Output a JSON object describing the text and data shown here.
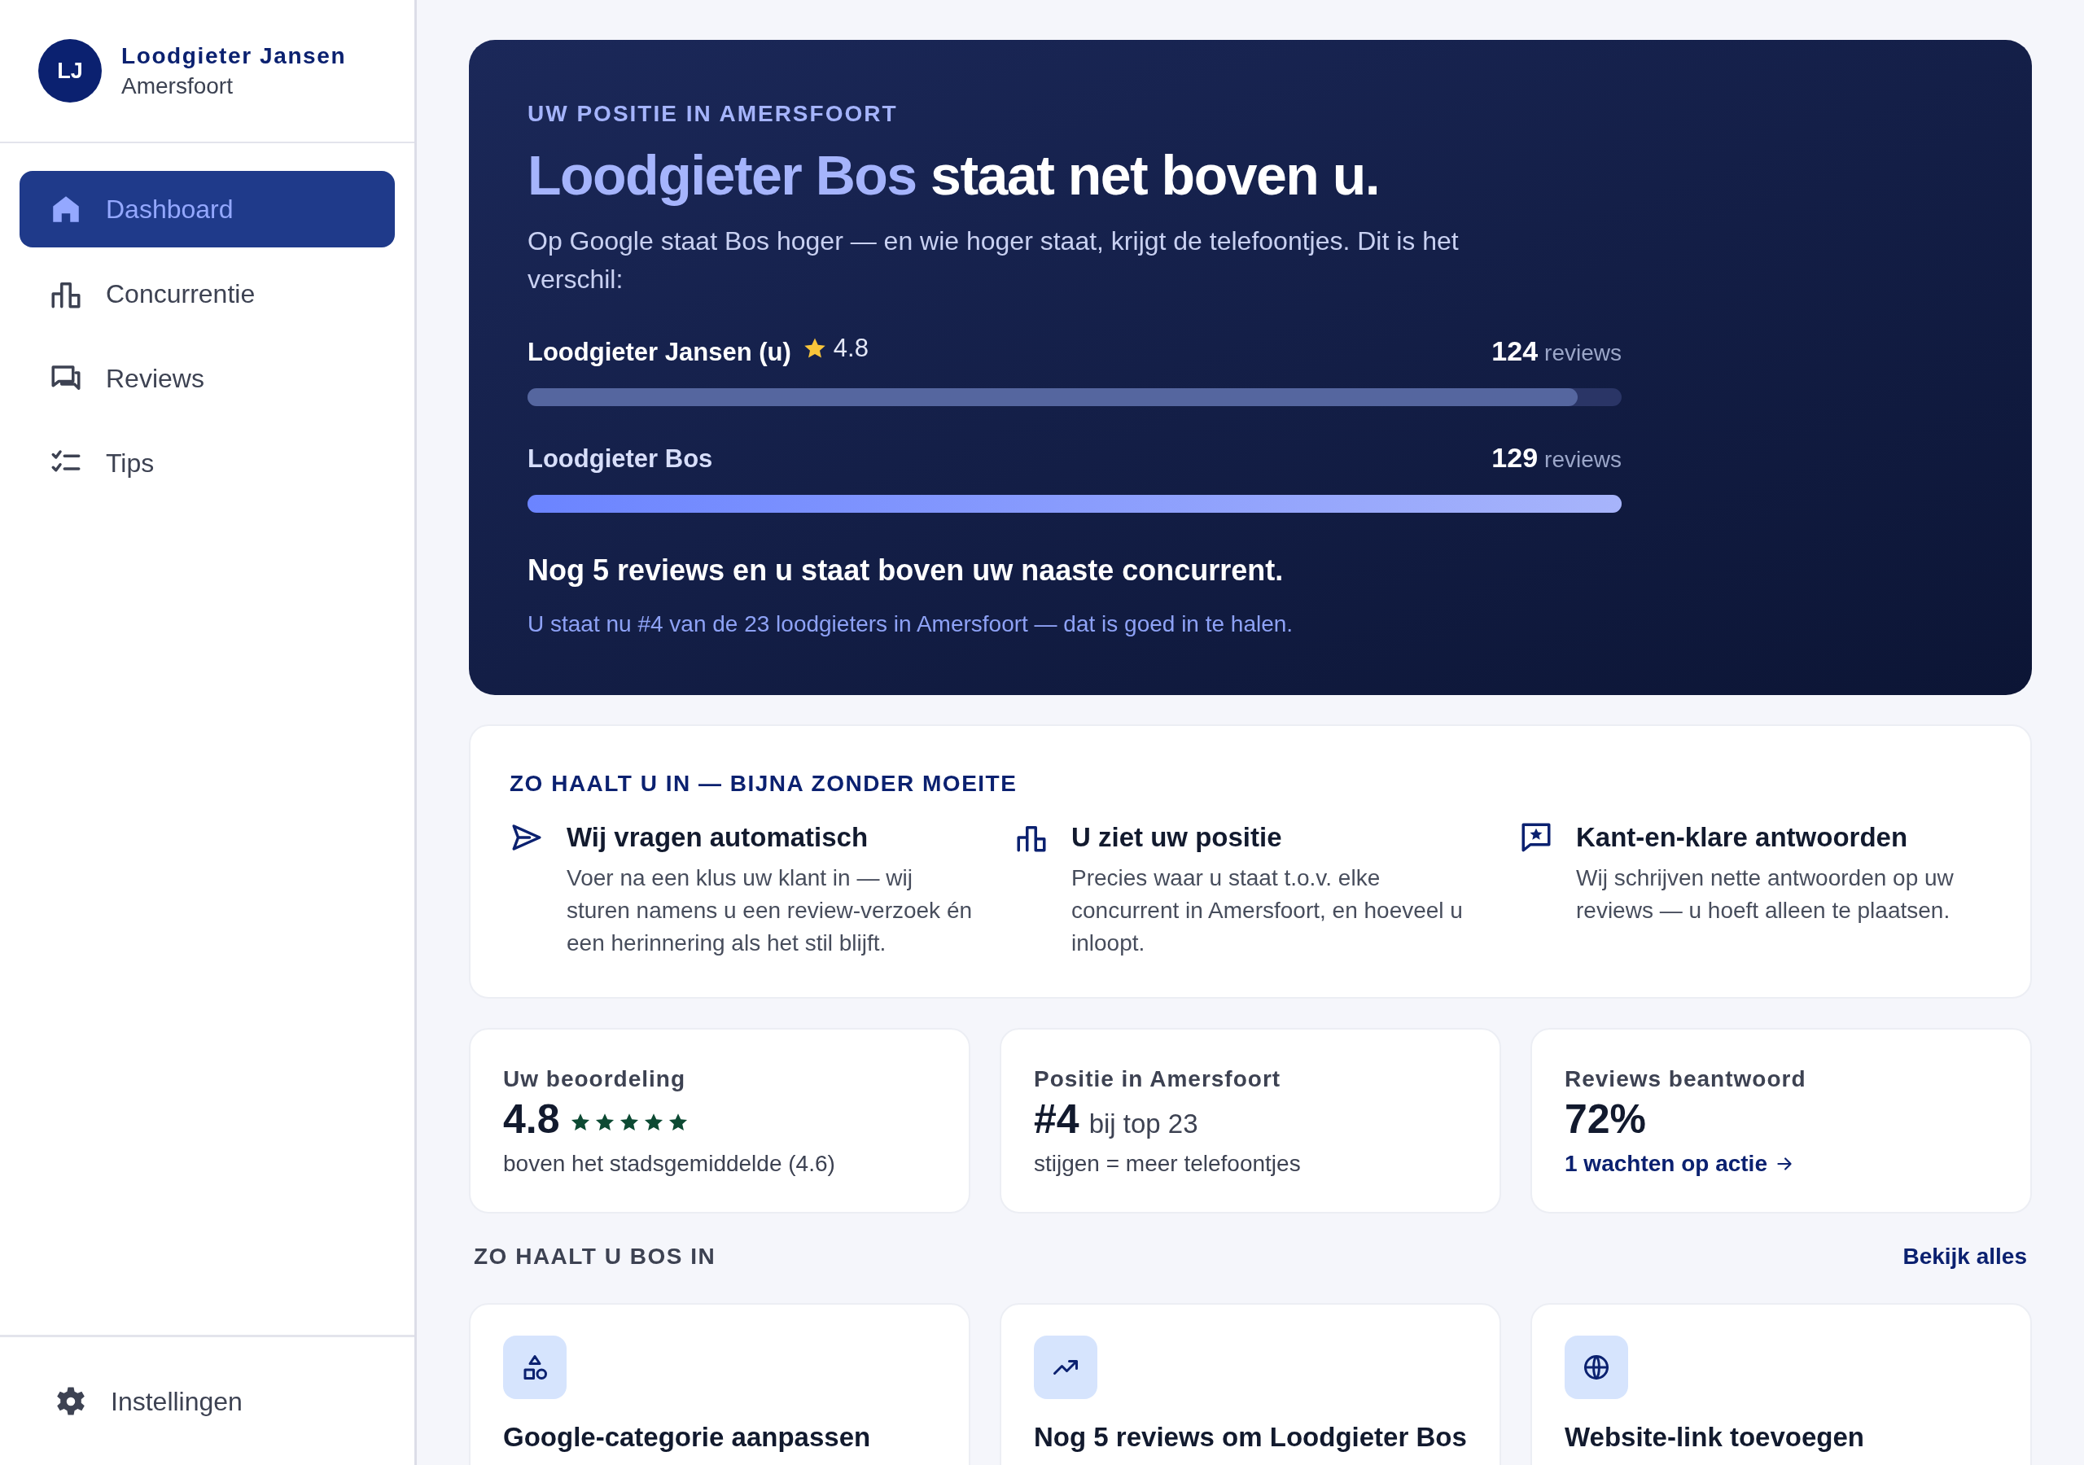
{
  "sidebar": {
    "avatar": "LJ",
    "name": "Loodgieter Jansen",
    "city": "Amersfoort",
    "items": [
      {
        "label": "Dashboard",
        "selected": true
      },
      {
        "label": "Concurrentie",
        "selected": false
      },
      {
        "label": "Reviews",
        "selected": false
      },
      {
        "label": "Tips",
        "selected": false
      }
    ],
    "footer": {
      "label": "Instellingen"
    }
  },
  "hero": {
    "eyebrow": "UW POSITIE IN AMERSFOORT",
    "headline_highlight": "Loodgieter Bos",
    "headline_rest": "staat net boven u.",
    "intro": "Op Google staat Bos hoger — en wie hoger staat, krijgt de telefoontjes. Dit is het verschil:",
    "competitors": [
      {
        "kind": "self",
        "name": "Loodgieter Jansen (u)",
        "rating": "4.8",
        "count": "124",
        "unit": "reviews",
        "level": 0.96
      },
      {
        "kind": "rival",
        "name": "Loodgieter Bos",
        "count": "129",
        "unit": "reviews",
        "level": 1
      }
    ],
    "callout": "Nog 5 reviews en u staat boven uw naaste concurrent.",
    "note": "U staat nu #4 van de 23 loodgieters in Amersfoort — dat is goed in te halen."
  },
  "how": {
    "title": "ZO HAALT U IN — BIJNA ZONDER MOEITE",
    "items": [
      {
        "title": "Wij vragen automatisch",
        "text": "Voer na een klus uw klant in — wij sturen namens u een review-verzoek én een herinnering als het stil blijft."
      },
      {
        "title": "U ziet uw positie",
        "text": "Precies waar u staat t.o.v. elke concurrent in Amersfoort, en hoeveel u inloopt."
      },
      {
        "title": "Kant-en-klare antwoorden",
        "text": "Wij schrijven nette antwoorden op uw reviews — u hoeft alleen te plaatsen."
      }
    ]
  },
  "stats": [
    {
      "label": "Uw beoordeling",
      "value": "4.8",
      "stars": 5,
      "sub": "boven het stadsgemiddelde (4.6)"
    },
    {
      "label": "Positie in Amersfoort",
      "value": "#4",
      "value_suffix": "bij top 23",
      "sub": "stijgen = meer telefoontjes"
    },
    {
      "label": "Reviews beantwoord",
      "value": "72%",
      "link": "1 wachten op actie"
    }
  ],
  "tips": {
    "title": "ZO HAALT U BOS IN",
    "link": "Bekijk alles",
    "items": [
      {
        "title": "Google-categorie aanpassen"
      },
      {
        "title": "Nog 5 reviews om Loodgieter Bos"
      },
      {
        "title": "Website-link toevoegen"
      }
    ]
  }
}
